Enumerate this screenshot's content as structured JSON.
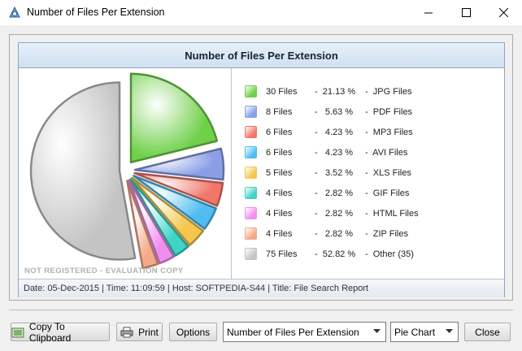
{
  "window": {
    "title": "Number of Files Per Extension",
    "controls": [
      "minimize",
      "maximize",
      "close"
    ]
  },
  "report": {
    "header": "Number of Files Per Extension",
    "watermark": "NOT REGISTERED - EVALUATION COPY",
    "status": "Date: 05-Dec-2015 | Time: 11:09:59 | Host: SOFTPEDIA-S44 | Title: File Search Report"
  },
  "chart_data": {
    "type": "pie",
    "categories": [
      "JPG Files",
      "PDF Files",
      "MP3 Files",
      "AVI Files",
      "XLS Files",
      "GIF Files",
      "HTML Files",
      "ZIP Files",
      "Other (35)"
    ],
    "values": [
      30,
      8,
      6,
      6,
      5,
      4,
      4,
      4,
      75
    ],
    "percents": [
      21.13,
      5.63,
      4.23,
      4.23,
      3.52,
      2.82,
      2.82,
      2.82,
      52.82
    ],
    "colors": [
      "#6fd04a",
      "#8a9ee6",
      "#f0776a",
      "#4fbdf0",
      "#f4c64e",
      "#3fd4c6",
      "#f08ef0",
      "#f4a98a",
      "#c4c4c4"
    ],
    "legend": [
      {
        "files": "30 Files",
        "pct": "-  21.13 %",
        "desc": "-  JPG Files"
      },
      {
        "files": "8 Files",
        "pct": "-   5.63 %",
        "desc": "-  PDF Files"
      },
      {
        "files": "6 Files",
        "pct": "-   4.23 %",
        "desc": "-  MP3 Files"
      },
      {
        "files": "6 Files",
        "pct": "-   4.23 %",
        "desc": "-  AVI Files"
      },
      {
        "files": "5 Files",
        "pct": "-   3.52 %",
        "desc": "-  XLS Files"
      },
      {
        "files": "4 Files",
        "pct": "-   2.82 %",
        "desc": "-  GIF Files"
      },
      {
        "files": "4 Files",
        "pct": "-   2.82 %",
        "desc": "-  HTML Files"
      },
      {
        "files": "4 Files",
        "pct": "-   2.82 %",
        "desc": "-  ZIP Files"
      },
      {
        "files": "75 Files",
        "pct": "-  52.82 %",
        "desc": "-  Other (35)"
      }
    ]
  },
  "toolbar": {
    "copy_label": "Copy To Clipboard",
    "print_label": "Print",
    "options_label": "Options",
    "report_select_value": "Number of Files Per Extension",
    "chart_select_value": "Pie Chart",
    "close_label": "Close"
  }
}
